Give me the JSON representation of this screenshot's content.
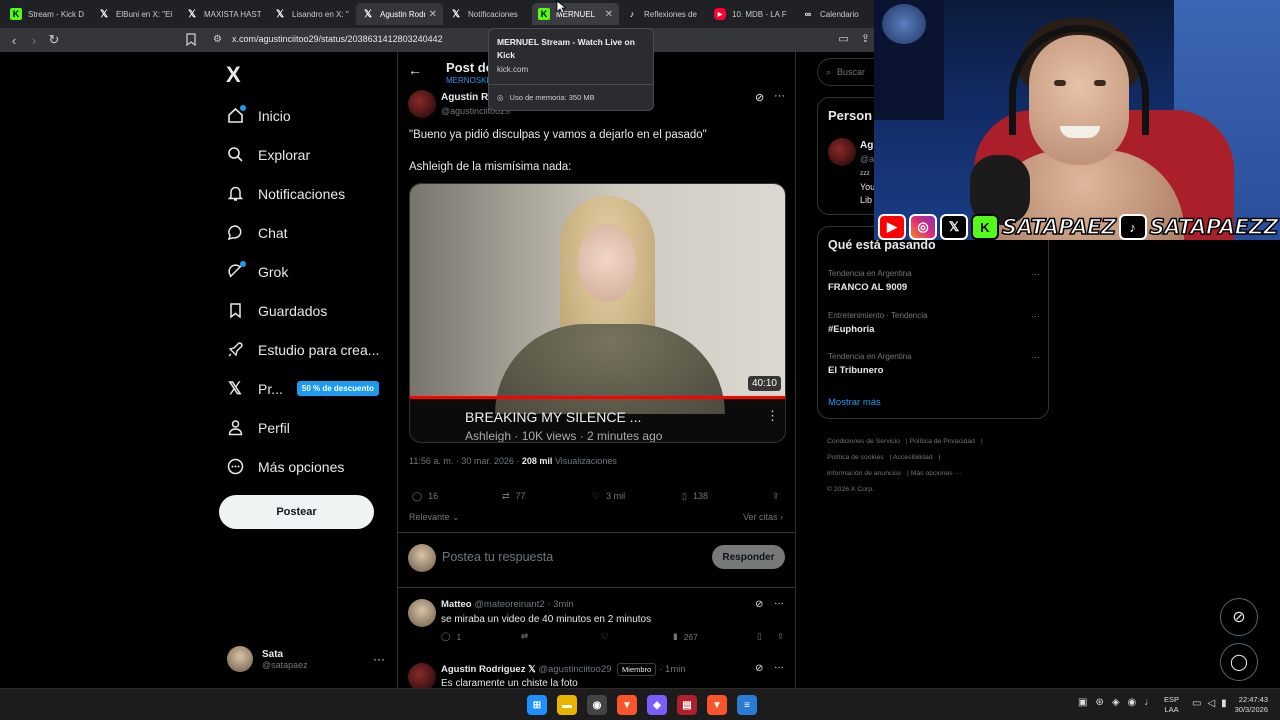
{
  "browser": {
    "tabs": [
      {
        "label": "Stream - Kick D",
        "icon": "kick"
      },
      {
        "label": "ElBuni en X: \"El",
        "icon": "x"
      },
      {
        "label": "MAXISTA HASTA",
        "icon": "x"
      },
      {
        "label": "Lisandro en X: \"",
        "icon": "x"
      },
      {
        "label": "Agustin Rodrigu",
        "icon": "x",
        "active": true
      },
      {
        "label": "Notificaciones",
        "icon": "x"
      },
      {
        "label": "MERNUEL",
        "icon": "kick"
      },
      {
        "label": "Reflexiones de",
        "icon": "tiktok"
      },
      {
        "label": "10. MDB - LA F",
        "icon": "youtube"
      },
      {
        "label": "Calendario",
        "icon": "calendar"
      }
    ],
    "url": "x.com/agustinciitoo29/status/2038631412803240442",
    "tooltip": {
      "title": "MERNUEL Stream - Watch Live on Kick",
      "domain": "kick.com",
      "memory": "Uso de memoria: 350 MB"
    }
  },
  "nav": {
    "logo": "X",
    "items": [
      {
        "label": "Inicio",
        "icon": "home-icon"
      },
      {
        "label": "Explorar",
        "icon": "search-icon"
      },
      {
        "label": "Notificaciones",
        "icon": "bell-icon"
      },
      {
        "label": "Chat",
        "icon": "chat-icon"
      },
      {
        "label": "Grok",
        "icon": "grok-icon"
      },
      {
        "label": "Guardados",
        "icon": "bookmark-icon"
      },
      {
        "label": "Estudio para crea...",
        "icon": "rocket-icon"
      },
      {
        "label": "Pr...",
        "icon": "x-premium-icon"
      },
      {
        "label": "Perfil",
        "icon": "person-icon"
      },
      {
        "label": "Más opciones",
        "icon": "more-circle-icon"
      }
    ],
    "promo_badge": "50 % de descuento",
    "post_button": "Postear",
    "account": {
      "name": "Sata",
      "handle": "@satapaez"
    }
  },
  "post": {
    "header_title": "Post de",
    "header_sub": "MERNOSKI",
    "author_name": "Agustin Ro",
    "author_handle": "@agustinciitoo29",
    "text1": "\"Bueno ya pidió disculpas y vamos a dejarlo en el pasado\"",
    "text2": "Ashleigh de la mismísima nada:",
    "video": {
      "duration": "40:10",
      "title": "BREAKING MY SILENCE ...",
      "meta": "Ashleigh · 10K views · 2 minutes ago"
    },
    "time": "11:56 a. m. · 30 mar. 2026 ·",
    "views": "208 mil",
    "views_label": "Visualizaciones",
    "replies": "16",
    "reposts": "77",
    "likes": "3 mil",
    "bookmarks": "138",
    "sort_label": "Relevante",
    "quotes_label": "Ver citas"
  },
  "composer": {
    "placeholder": "Postea tu respuesta",
    "button": "Responder"
  },
  "comments": [
    {
      "name": "Matteo",
      "handle": "@mateoreinant2",
      "time": "· 3min",
      "badge": "",
      "text": "se miraba un video de 40 minutos en 2 minutos",
      "replies": "1",
      "views": "267"
    },
    {
      "name": "Agustin Rodriguez 𝕏",
      "handle": "@agustinciitoo29",
      "time": "· 1min",
      "badge": "Miembro",
      "text": "Es claramente un chiste la foto",
      "replies": "",
      "views": ""
    }
  ],
  "right": {
    "search_placeholder": "Buscar",
    "persons_title": "Person",
    "person": {
      "name": "Ag",
      "handle": "@a",
      "bio": "ᶻᶻᶻ\nYou\nLib"
    },
    "trends_title": "Qué está pasando",
    "trends": [
      {
        "category": "Tendencia en Argentina",
        "name": "FRANCO AL 9009"
      },
      {
        "category": "Entretenimiento · Tendencia",
        "name": "#Euphoria"
      },
      {
        "category": "Tendencia en Argentina",
        "name": "El Tribunero"
      }
    ],
    "show_more": "Mostrar más",
    "footer": [
      "Condiciones de Servicio",
      "Política de Privacidad",
      "Política de cookies",
      "Accesibilidad",
      "Información de anuncios",
      "Más opciones ···",
      "© 2026 X Corp."
    ]
  },
  "overlay": {
    "handle1": "SATAPAEZ",
    "handle2": "SATAPAEZZ"
  },
  "taskbar": {
    "lang": "ESP",
    "layout": "LAA",
    "time": "22:47:43",
    "date": "30/3/2026"
  }
}
